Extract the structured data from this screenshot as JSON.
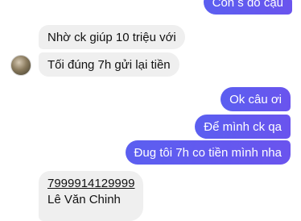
{
  "messages": {
    "out_top": "Còn s đó cậu",
    "in_1": "Nhờ ck giúp 10 triệu với",
    "in_2": "Tối đúng 7h gửi lại tiền",
    "out_1": "Ok câu ơi",
    "out_2": "Để mình ck qa",
    "out_3": "Đug tôi 7h co tiền mình nha",
    "account_number": "7999914129999",
    "account_name": "Lê Văn Chinh"
  },
  "colors": {
    "outgoing_bubble": "#5b5ff0",
    "incoming_bubble": "#efefef"
  }
}
